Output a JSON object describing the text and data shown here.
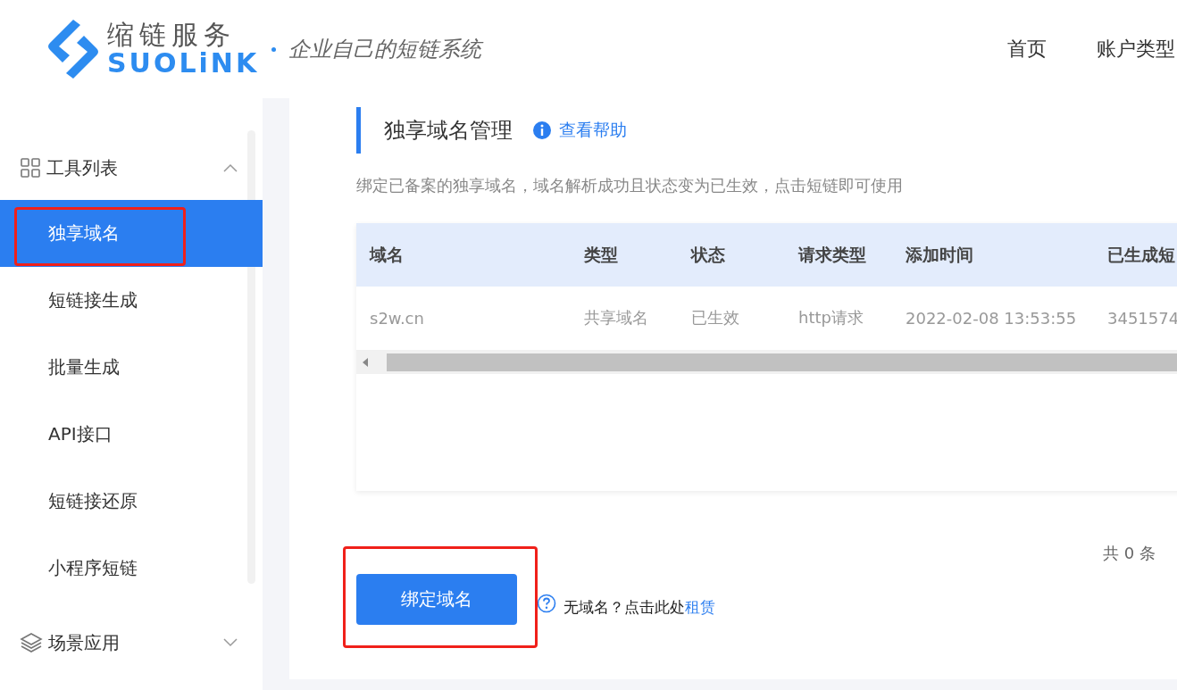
{
  "header": {
    "logo_cn": "缩链服务",
    "logo_en": "SUOLiNK",
    "slogan": "企业自己的短链系统",
    "nav": [
      {
        "label": "首页"
      },
      {
        "label": "账户类型"
      }
    ]
  },
  "sidebar": {
    "groups": [
      {
        "label": "工具列表",
        "expanded": true,
        "items": [
          {
            "label": "独享域名",
            "selected": true,
            "highlighted": true
          },
          {
            "label": "短链接生成",
            "selected": false,
            "highlighted": false
          },
          {
            "label": "批量生成",
            "selected": false,
            "highlighted": false
          },
          {
            "label": "API接口",
            "selected": false,
            "highlighted": false
          },
          {
            "label": "短链接还原",
            "selected": false,
            "highlighted": false
          },
          {
            "label": "小程序短链",
            "selected": false,
            "highlighted": false
          }
        ]
      },
      {
        "label": "场景应用",
        "expanded": false
      }
    ]
  },
  "page": {
    "title": "独享域名管理",
    "help_link": "查看帮助",
    "description": "绑定已备案的独享域名，域名解析成功且状态变为已生效，点击短链即可使用"
  },
  "table": {
    "columns": [
      "域名",
      "类型",
      "状态",
      "请求类型",
      "添加时间",
      "已生成短"
    ],
    "rows": [
      [
        "s2w.cn",
        "共享域名",
        "已生效",
        "http请求",
        "2022-02-08 13:53:55",
        "3451574"
      ]
    ]
  },
  "pagination": {
    "total": "共 0 条"
  },
  "bind_button": {
    "label": "绑定域名",
    "highlighted": true
  },
  "hint": {
    "text": "无域名？点击此处",
    "link": "租赁"
  }
}
